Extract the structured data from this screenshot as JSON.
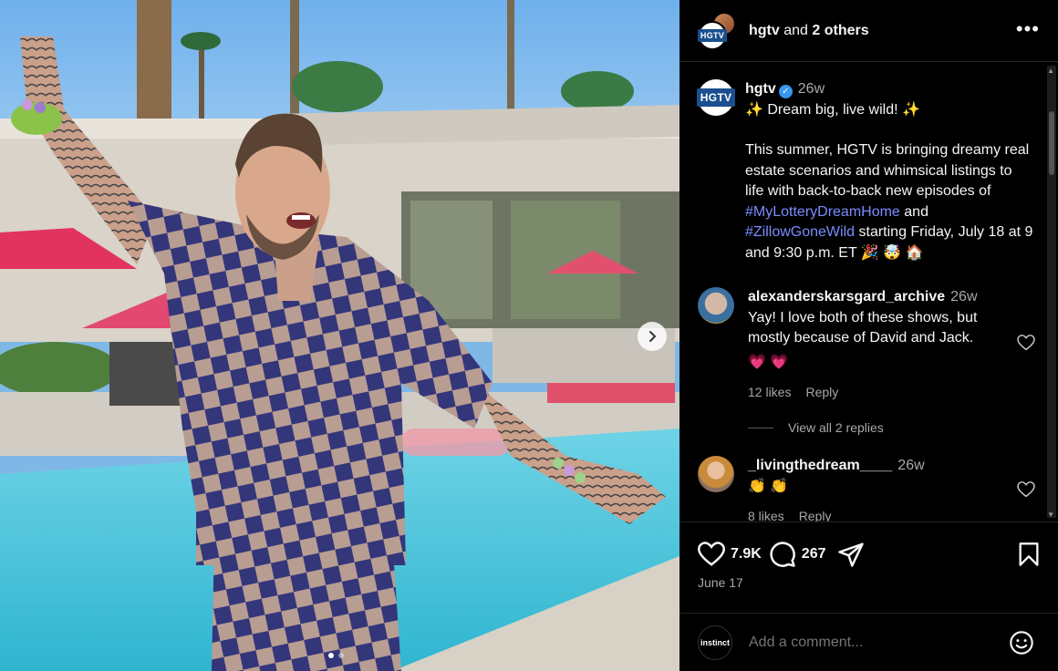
{
  "header": {
    "account": "hgtv",
    "and_text": "and",
    "others": "2 others",
    "logo_text": "HGTV",
    "more_icon": "more-horizontal-icon"
  },
  "caption": {
    "username": "hgtv",
    "time": "26w",
    "headline": "Dream big, live wild!",
    "text1": "This summer, HGTV is bringing dreamy real estate scenarios and whimsical listings to life with back-to-back new episodes of ",
    "tag1": "#MyLotteryDreamHome",
    "text2": " and ",
    "tag2": "#ZillowGoneWild",
    "text3": " starting Friday, July 18 at 9 and 9:30 p.m. ET 🎉 🤯 🏠"
  },
  "comments": [
    {
      "username": "alexanderskarsgard_archive",
      "time": "26w",
      "text": "Yay! I love both of these shows, but mostly because of David and Jack.",
      "emoji": "💗 💗",
      "likes": "12 likes",
      "reply": "Reply"
    },
    {
      "username": "_livingthedream____",
      "time": "26w",
      "text": "👏 👏",
      "likes": "8 likes",
      "reply": "Reply"
    }
  ],
  "view_replies": "View all 2 replies",
  "actions": {
    "likes": "7.9K",
    "comments": "267",
    "date": "June 17"
  },
  "add_comment": {
    "avatar_text": "instinct",
    "placeholder": "Add a comment..."
  },
  "carousel": {
    "slides": 2,
    "active": 1
  }
}
